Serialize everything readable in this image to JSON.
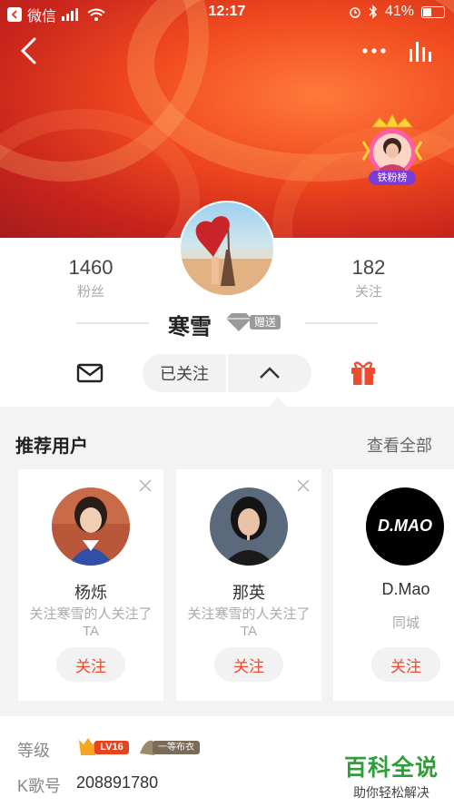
{
  "status_bar": {
    "carrier": "微信",
    "time": "12:17",
    "battery": "41%",
    "battery_level": 0.41
  },
  "profile": {
    "fans_count": "1460",
    "fans_label": "粉丝",
    "following_count": "182",
    "following_label": "关注",
    "name": "寒雪",
    "gift_badge_text": "赠送",
    "fan_rank_badge_text": "铁粉榜"
  },
  "actions": {
    "followed_label": "已关注"
  },
  "recommend": {
    "title": "推荐用户",
    "see_all": "查看全部",
    "users": [
      {
        "name": "杨烁",
        "desc": "关注寒雪的人关注了TA",
        "button": "关注"
      },
      {
        "name": "那英",
        "desc": "关注寒雪的人关注了TA",
        "button": "关注"
      },
      {
        "name": "D.Mao",
        "desc": "同城",
        "button": "关注",
        "avatar_text": "D.MAO"
      }
    ]
  },
  "info": {
    "level_label": "等级",
    "level_badge": "LV16",
    "rank_badge": "一等布衣",
    "kid_label": "K歌号",
    "kid_value": "208891780"
  },
  "watermark": {
    "title": "百科全说",
    "subtitle": "助你轻松解决"
  },
  "colors": {
    "accent": "#f04b2f",
    "banner": "#e8421f",
    "watermark": "#2f9e3a"
  }
}
